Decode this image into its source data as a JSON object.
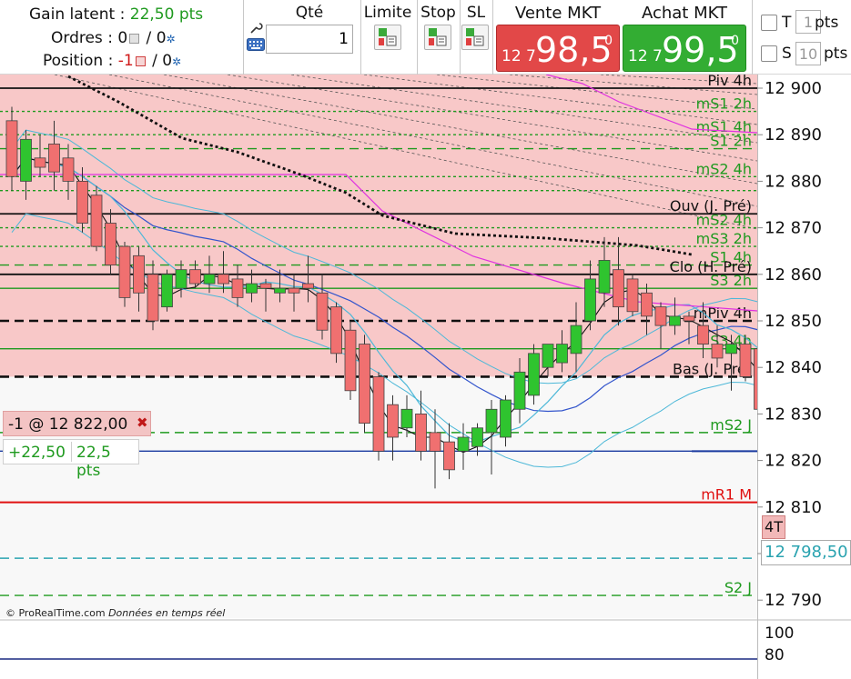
{
  "account": {
    "gain_label": "Gain latent :",
    "gain_value": "22,50 pts",
    "orders_label": "Ordres : 0",
    "orders_sep": " / 0",
    "position_label": "Position :",
    "position_value": "-1",
    "position_sep": " / 0"
  },
  "order_ticket": {
    "qty_label": "Qté",
    "qty_value": "1",
    "limit_label": "Limite",
    "stop_label": "Stop",
    "sl_label": "SL"
  },
  "market": {
    "sell_label": "Vente MKT",
    "sell_prefix": "12 7",
    "sell_main": "98,5",
    "sell_sup": "0",
    "buy_label": "Achat MKT",
    "buy_prefix": "12 7",
    "buy_main": "99,5",
    "buy_sup": "0"
  },
  "options": {
    "t_label": "T",
    "t_value": "1",
    "t_unit": "pts",
    "s_label": "S",
    "s_value": "10",
    "s_unit": "pts"
  },
  "colors": {
    "sell": "#e24848",
    "buy": "#33ad33",
    "bull_candle": "#2fc42f",
    "bear_candle": "#f07070",
    "zone": "#f8c8c8",
    "level_green": "#1f9a1f",
    "level_red": "#e01010",
    "price_cyan": "#2aa3b0"
  },
  "chart_data": {
    "type": "candlestick",
    "ylim": [
      12786,
      12904
    ],
    "y_ticks": [
      12790,
      12800,
      12810,
      12820,
      12830,
      12840,
      12850,
      12860,
      12870,
      12880,
      12890,
      12900
    ],
    "y_tick_labels": [
      "12 790",
      "",
      "12 810",
      "12 820",
      "12 830",
      "12 840",
      "12 850",
      "12 860",
      "12 870",
      "12 880",
      "12 890",
      "12 900"
    ],
    "indicator_ticks": [
      "100",
      "80"
    ],
    "candles": [
      [
        12893,
        12896,
        12878,
        12881
      ],
      [
        12880,
        12891,
        12876,
        12889
      ],
      [
        12885,
        12890,
        12881,
        12883
      ],
      [
        12888,
        12893,
        12878,
        12882
      ],
      [
        12885,
        12888,
        12876,
        12880
      ],
      [
        12880,
        12883,
        12869,
        12871
      ],
      [
        12877,
        12879,
        12865,
        12866
      ],
      [
        12871,
        12874,
        12860,
        12862
      ],
      [
        12866,
        12867,
        12853,
        12855
      ],
      [
        12864,
        12866,
        12852,
        12856
      ],
      [
        12860,
        12863,
        12848,
        12850
      ],
      [
        12853,
        12861,
        12852,
        12860
      ],
      [
        12857,
        12863,
        12855,
        12861
      ],
      [
        12861,
        12863,
        12857,
        12858
      ],
      [
        12858,
        12864,
        12856,
        12860
      ],
      [
        12860,
        12865,
        12856,
        12858
      ],
      [
        12859,
        12862,
        12853,
        12855
      ],
      [
        12856,
        12861,
        12854,
        12858
      ],
      [
        12858,
        12859,
        12852,
        12857
      ],
      [
        12856,
        12861,
        12854,
        12857
      ],
      [
        12857,
        12860,
        12852,
        12856
      ],
      [
        12858,
        12864,
        12854,
        12857
      ],
      [
        12856,
        12860,
        12846,
        12848
      ],
      [
        12853,
        12854,
        12841,
        12843
      ],
      [
        12848,
        12850,
        12833,
        12835
      ],
      [
        12845,
        12847,
        12826,
        12828
      ],
      [
        12838,
        12839,
        12820,
        12822
      ],
      [
        12832,
        12834,
        12820,
        12825
      ],
      [
        12827,
        12834,
        12825,
        12831
      ],
      [
        12830,
        12835,
        12820,
        12822
      ],
      [
        12826,
        12831,
        12814,
        12822
      ],
      [
        12824,
        12828,
        12816,
        12818
      ],
      [
        12822,
        12828,
        12818,
        12825
      ],
      [
        12823,
        12828,
        12821,
        12827
      ],
      [
        12826,
        12833,
        12817,
        12831
      ],
      [
        12825,
        12834,
        12823,
        12833
      ],
      [
        12831,
        12842,
        12828,
        12839
      ],
      [
        12834,
        12845,
        12832,
        12843
      ],
      [
        12840,
        12845,
        12838,
        12845
      ],
      [
        12841,
        12848,
        12839,
        12845
      ],
      [
        12843,
        12854,
        12839,
        12849
      ],
      [
        12850,
        12863,
        12848,
        12859
      ],
      [
        12856,
        12868,
        12853,
        12863
      ],
      [
        12861,
        12868,
        12849,
        12853
      ],
      [
        12859,
        12860,
        12851,
        12852
      ],
      [
        12856,
        12858,
        12847,
        12851
      ],
      [
        12853,
        12854,
        12844,
        12849
      ],
      [
        12849,
        12855,
        12847,
        12851
      ],
      [
        12851,
        12852,
        12845,
        12850
      ],
      [
        12849,
        12854,
        12842,
        12845
      ],
      [
        12845,
        12849,
        12840,
        12842
      ],
      [
        12843,
        12847,
        12835,
        12845
      ],
      [
        12845,
        12847,
        12837,
        12838
      ],
      [
        12844,
        12845,
        12827,
        12831
      ],
      [
        12838,
        12840,
        12818,
        12823
      ],
      [
        12832,
        12838,
        12807,
        12812
      ],
      [
        12828,
        12829,
        12810,
        12814
      ],
      [
        12817,
        12818,
        12802,
        12803
      ]
    ],
    "levels": [
      {
        "value": 12900,
        "label": "Piv 4h",
        "color": "#111111",
        "style": "solid"
      },
      {
        "value": 12895,
        "label": "mS1 2h",
        "color": "#1f9a1f",
        "style": "dotted"
      },
      {
        "value": 12890,
        "label": "mS1 4h",
        "color": "#1f9a1f",
        "style": "dotted"
      },
      {
        "value": 12887,
        "label": "S1 2h",
        "color": "#1f9a1f",
        "style": "dashed"
      },
      {
        "value": 12881,
        "label": "mS2 4h",
        "color": "#1f9a1f",
        "style": "dotted"
      },
      {
        "value": 12878,
        "label": "",
        "color": "#1f9a1f",
        "style": "dotted"
      },
      {
        "value": 12873,
        "label": "Ouv (J. Pré)",
        "color": "#111111",
        "style": "solid"
      },
      {
        "value": 12870,
        "label": "mS2 4h",
        "color": "#1f9a1f",
        "style": "dotted"
      },
      {
        "value": 12866,
        "label": "mS3 2h",
        "color": "#1f9a1f",
        "style": "dotted"
      },
      {
        "value": 12862,
        "label": "S1 4h",
        "color": "#1f9a1f",
        "style": "dashed"
      },
      {
        "value": 12860,
        "label": "Clo (H. Pré)",
        "color": "#111111",
        "style": "solid"
      },
      {
        "value": 12857,
        "label": "S3 2h",
        "color": "#1f9a1f",
        "style": "solid"
      },
      {
        "value": 12850,
        "label": "mPiv 4h",
        "color": "#111111",
        "style": "dashed"
      },
      {
        "value": 12844,
        "label": "S3 4h",
        "color": "#1f9a1f",
        "style": "solid"
      },
      {
        "value": 12838,
        "label": "Bas (J. Pré)",
        "color": "#111111",
        "style": "dashed"
      },
      {
        "value": 12826,
        "label": "mS2 J",
        "color": "#1f9a1f",
        "style": "dashed"
      },
      {
        "value": 12822,
        "label": "",
        "color": "#1a3aa0",
        "style": "solid"
      },
      {
        "value": 12811,
        "label": "mR1 M",
        "color": "#e01010",
        "style": "solid"
      },
      {
        "value": 12799,
        "label": "",
        "color": "#2aa3b0",
        "style": "dashed"
      },
      {
        "value": 12791,
        "label": "S2 J",
        "color": "#1f9a1f",
        "style": "dashed"
      }
    ],
    "zone_range": [
      12838,
      12904
    ],
    "current_price": "12 798,50"
  },
  "chart_labels": {
    "tag_4t": "4T"
  },
  "position_box": {
    "text": "-1 @ 12 822,00",
    "gain": "+22,50",
    "gain_pts": "22,5 pts"
  },
  "footer": {
    "brand": "© ProRealTime.com",
    "feed": "Données en temps réel"
  }
}
